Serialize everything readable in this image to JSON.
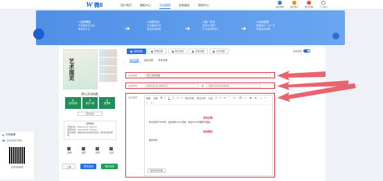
{
  "header": {
    "logo_w": "W",
    "logo_text": "微8",
    "nav": [
      "用户首页",
      "模板中心",
      "活动管理",
      "定制服务",
      "帮助中心"
    ],
    "tools": [
      "消息通知",
      "会员中心",
      "账户管理",
      "个人中心"
    ]
  },
  "banner": {
    "steps": [
      {
        "title": "1.选择模板",
        "lines": [
          "丰富模板任你选",
          "覆盖多行业"
        ]
      },
      {
        "title": "2.创建活动",
        "lines": [
          "在线编辑内容",
          "快速完成配置"
        ]
      },
      {
        "title": "3.推广活动",
        "lines": [
          "多种方式推广",
          "扩大活动影响力"
        ]
      },
      {
        "title": "4.完成效果",
        "lines": [
          "数据统计一目了然",
          "掌握活动效果"
        ]
      }
    ]
  },
  "activity_types": [
    "活动设置",
    "投票设置",
    "报名设置",
    "奖品设置",
    "分享设置"
  ],
  "toggle_label": "活动状态",
  "subtabs": [
    "基本设置",
    "高级设置",
    "其他设置"
  ],
  "left": {
    "cover_title": "艺术展览",
    "title": "默认活动标题",
    "stats": [
      {
        "value": "0",
        "label": "总浏览量"
      },
      {
        "value": "0",
        "label": "报名人数"
      },
      {
        "value": "0",
        "label": "投票数"
      }
    ],
    "preview_label": "预览活动",
    "info_header": "活动信息",
    "info": [
      "开始时间：2024-02-21 16:00:24",
      "结束时间：2024-03-05 16:00:24",
      "活动说明：模板活动请先修改活动，再对外发布使用"
    ],
    "icons": [
      "二维码",
      "报名",
      "投票",
      "设置"
    ],
    "actions": [
      "上架",
      "发布活动",
      "保存活动"
    ]
  },
  "sidebar": {
    "service": "在线客服",
    "phone": "17071577790",
    "qr_label": "扫码添加客服"
  },
  "form": {
    "title_label": "活动标题",
    "title_value": "默认活动标题",
    "time_label": "活动时间",
    "start": "2024-02-21 16:00:24",
    "to": "至",
    "end": "2024-03-05 16:00:24",
    "desc_label": "活动说明"
  },
  "editor": {
    "toolbar": [
      "段落",
      "字体",
      "B",
      "I",
      "U",
      "S",
      "A",
      "≡",
      "默认字体",
      "默认字号",
      "行高",
      "H",
      "≡",
      "⊞",
      "“”",
      "</>",
      "⌫",
      "☺",
      "▣",
      "▤",
      "—",
      "↶",
      "↷",
      "⊡"
    ],
    "heading1": "活动主题",
    "body1": "本次活动于2024年，在此举办XXXX活动，欢迎XXXX积极参与报名。",
    "heading2": "活动规则",
    "body2": "报名时间：",
    "save": "保存活动内容"
  },
  "colors": {
    "primary": "#2c6fe0",
    "red": "#e0303a",
    "green": "#1f8f5a"
  }
}
